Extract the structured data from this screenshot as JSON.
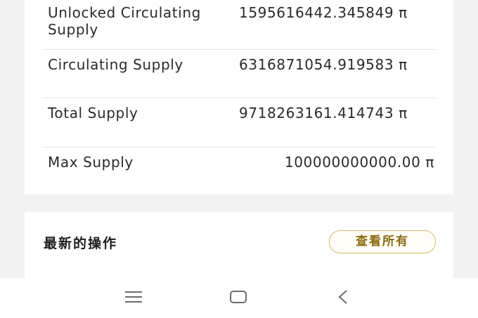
{
  "supply": {
    "rows": [
      {
        "label": "Unlocked Circulating Supply",
        "value": "1595616442.345849 π"
      },
      {
        "label": "Circulating Supply",
        "value": "6316871054.919583 π"
      },
      {
        "label": "Total Supply",
        "value": "9718263161.414743 π"
      },
      {
        "label": "Max Supply",
        "value": "100000000000.00 π"
      }
    ]
  },
  "operations": {
    "title": "最新的操作",
    "view_all_label": "查看所有"
  },
  "navbar": {
    "icons": [
      "recent-apps-icon",
      "home-icon",
      "back-icon"
    ]
  }
}
